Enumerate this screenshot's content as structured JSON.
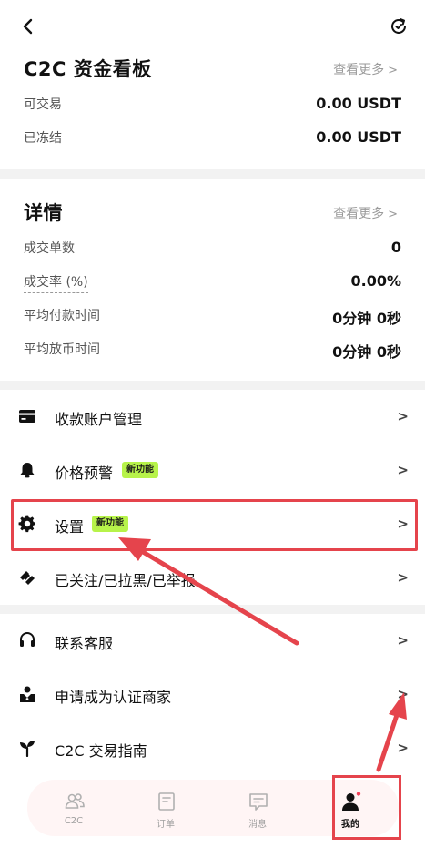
{
  "header": {
    "back_icon": "chevron-left-icon",
    "refresh_icon": "refresh-icon"
  },
  "dashboard": {
    "title": "C2C 资金看板",
    "more": "查看更多",
    "rows": [
      {
        "label": "可交易",
        "value": "0.00 USDT"
      },
      {
        "label": "已冻结",
        "value": "0.00 USDT"
      }
    ]
  },
  "details": {
    "title": "详情",
    "more": "查看更多",
    "rows": [
      {
        "label": "成交单数",
        "value": "0"
      },
      {
        "label": "成交率 (%)",
        "value": "0.00%"
      },
      {
        "label": "平均付款时间",
        "value": "0分钟 0秒"
      },
      {
        "label": "平均放币时间",
        "value": "0分钟 0秒"
      }
    ]
  },
  "menu": {
    "group1": [
      {
        "label": "收款账户管理",
        "icon": "card-icon"
      },
      {
        "label": "价格预警",
        "icon": "bell-icon",
        "badge": "新功能"
      },
      {
        "label": "设置",
        "icon": "gear-icon",
        "badge": "新功能"
      },
      {
        "label": "已关注/已拉黑/已举报",
        "icon": "tag-icon"
      }
    ],
    "group2": [
      {
        "label": "联系客服",
        "icon": "headset-icon"
      },
      {
        "label": "申请成为认证商家",
        "icon": "merchant-icon"
      },
      {
        "label": "C2C 交易指南",
        "icon": "sprout-icon"
      }
    ]
  },
  "bottom_nav": {
    "items": [
      {
        "label": "C2C",
        "icon": "users-icon",
        "active": false
      },
      {
        "label": "订单",
        "icon": "order-icon",
        "active": false
      },
      {
        "label": "消息",
        "icon": "message-icon",
        "active": false
      },
      {
        "label": "我的",
        "icon": "profile-icon",
        "active": true
      }
    ]
  },
  "colors": {
    "badge": "#b7f34a",
    "annotation_red": "#e5444c",
    "nav_bg": "#fff5f5"
  }
}
